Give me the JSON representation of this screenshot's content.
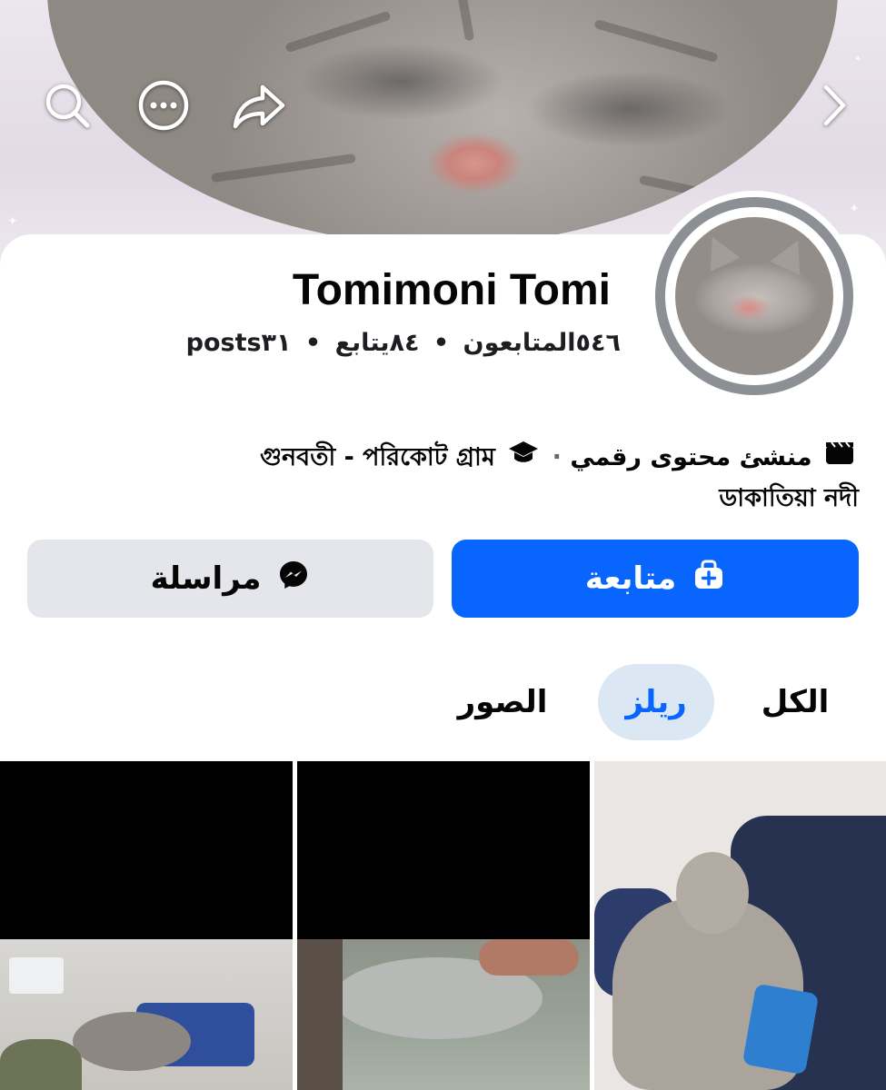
{
  "cover": {
    "actions": {
      "search": "search-icon",
      "more": "more-icon",
      "share": "share-icon",
      "next": "chevron-right-icon"
    }
  },
  "profile": {
    "name": "Tomimoni Tomi",
    "stats": {
      "followers": "٥٤٦المتابعون",
      "following": "٨٤يتابع",
      "posts": "posts٣١",
      "separator": "•"
    },
    "bio": {
      "category": "منشئ محتوى رقمي",
      "dot": "·",
      "education": "গুনবতী - পরিকোট গ্রাম",
      "location": "ডাকাতিয়া নদী"
    }
  },
  "buttons": {
    "follow": "متابعة",
    "message": "مراسلة"
  },
  "tabs": {
    "all": "الكل",
    "reels": "ريلز",
    "photos": "الصور"
  },
  "colors": {
    "primary": "#0866ff",
    "secondary_button": "#e4e6eb",
    "active_tab_bg": "#dbe7f2",
    "text": "#050505",
    "avatar_ring": "#8c9095"
  }
}
